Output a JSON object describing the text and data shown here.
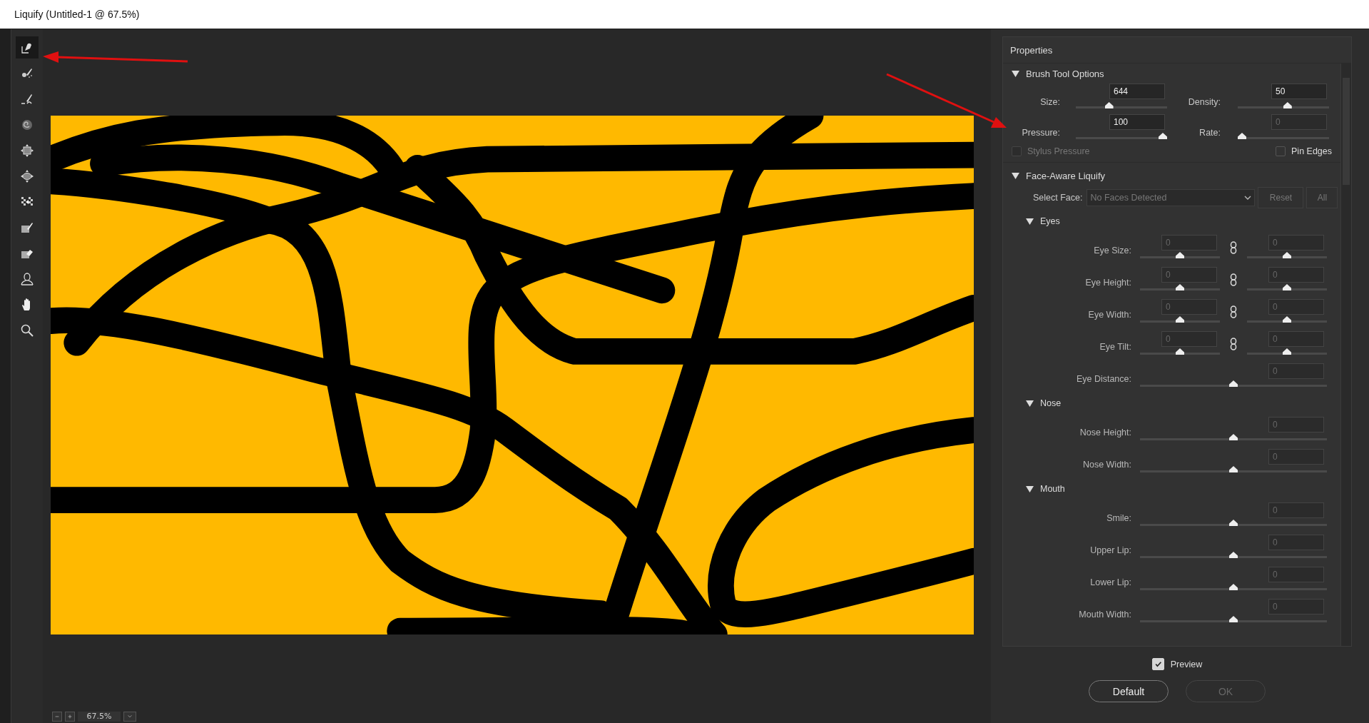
{
  "window": {
    "title": "Liquify (Untitled-1 @ 67.5%)"
  },
  "tools": [
    {
      "kind": "warp",
      "selected": true
    },
    {
      "kind": "reconstruct",
      "selected": false
    },
    {
      "kind": "smooth",
      "selected": false
    },
    {
      "kind": "twirl",
      "selected": false
    },
    {
      "kind": "pucker",
      "selected": false
    },
    {
      "kind": "bloat",
      "selected": false
    },
    {
      "kind": "push",
      "selected": false
    },
    {
      "kind": "freeze",
      "selected": false
    },
    {
      "kind": "thaw",
      "selected": false
    },
    {
      "kind": "face",
      "selected": false
    },
    {
      "kind": "hand",
      "selected": false
    },
    {
      "kind": "zoom",
      "selected": false
    }
  ],
  "zoom_bar": {
    "value": "67.5%"
  },
  "properties": {
    "title": "Properties",
    "brush_tool_options": {
      "title": "Brush Tool Options",
      "expanded": true,
      "fields": [
        {
          "label": "Size:",
          "value": "644",
          "level": 0.35,
          "disabled": false
        },
        {
          "label": "Density:",
          "value": "50",
          "level": 0.55,
          "disabled": false
        },
        {
          "label": "Pressure:",
          "value": "100",
          "level": 1,
          "disabled": false
        },
        {
          "label": "Rate:",
          "value": "0",
          "level": 0,
          "disabled": true
        }
      ],
      "checkboxes": [
        {
          "label": "Stylus Pressure",
          "checked": false,
          "disabled": true
        },
        {
          "label": "Pin Edges",
          "checked": false,
          "disabled": false
        }
      ]
    },
    "face_aware_liquify": {
      "title": "Face-Aware Liquify",
      "expanded": true,
      "select_face": {
        "label": "Select Face:",
        "value": "No Faces Detected"
      },
      "buttons": [
        "Reset",
        "All"
      ],
      "groups": [
        {
          "title": "Eyes",
          "expanded": true,
          "rows": [
            {
              "kind": "paired",
              "label": "Eye Size:",
              "left": {
                "value": "0",
                "level": 0.5
              },
              "right": {
                "value": "0",
                "level": 0.5
              }
            },
            {
              "kind": "paired",
              "label": "Eye Height:",
              "left": {
                "value": "0",
                "level": 0.5
              },
              "right": {
                "value": "0",
                "level": 0.5
              }
            },
            {
              "kind": "paired",
              "label": "Eye Width:",
              "left": {
                "value": "0",
                "level": 0.5
              },
              "right": {
                "value": "0",
                "level": 0.5
              }
            },
            {
              "kind": "paired",
              "label": "Eye Tilt:",
              "left": {
                "value": "0",
                "level": 0.5
              },
              "right": {
                "value": "0",
                "level": 0.5
              }
            },
            {
              "kind": "single",
              "label": "Eye Distance:",
              "value": "0",
              "level": 0.5
            }
          ]
        },
        {
          "title": "Nose",
          "expanded": true,
          "rows": [
            {
              "kind": "single",
              "label": "Nose Height:",
              "value": "0",
              "level": 0.5
            },
            {
              "kind": "single",
              "label": "Nose Width:",
              "value": "0",
              "level": 0.5
            }
          ]
        },
        {
          "title": "Mouth",
          "expanded": true,
          "rows": [
            {
              "kind": "single",
              "label": "Smile:",
              "value": "0",
              "level": 0.5
            },
            {
              "kind": "single",
              "label": "Upper Lip:",
              "value": "0",
              "level": 0.5
            },
            {
              "kind": "single",
              "label": "Lower Lip:",
              "value": "0",
              "level": 0.5
            },
            {
              "kind": "single",
              "label": "Mouth Width:",
              "value": "0",
              "level": 0.5
            }
          ]
        }
      ]
    }
  },
  "preview": {
    "label": "Preview",
    "checked": true
  },
  "buttons": [
    {
      "label": "Default",
      "disabled": false
    },
    {
      "label": "OK",
      "disabled": true
    }
  ]
}
